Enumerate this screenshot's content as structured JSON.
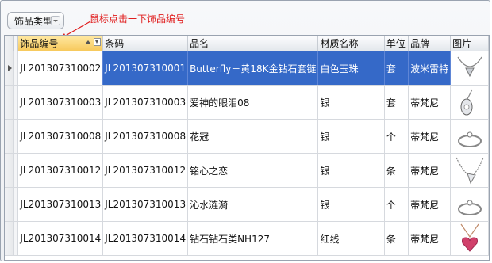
{
  "group_panel": {
    "chip_label": "饰品类型"
  },
  "hint_text": "鼠标点击一下饰品编号",
  "columns": [
    "饰品编号",
    "条码",
    "品名",
    "材质名称",
    "单位",
    "品牌",
    "图片"
  ],
  "rows": [
    {
      "id": "JL201307310002",
      "barcode": "JL201307310001",
      "name": "Butterfly－黄18K金钻石套链",
      "material": "白色玉珠",
      "unit": "套",
      "brand": "波米雷特",
      "picture": "necklace-icon"
    },
    {
      "id": "JL201307310003",
      "barcode": "JL201307310003",
      "name": "爱神的眼泪08",
      "material": "银",
      "unit": "套",
      "brand": "蒂梵尼",
      "picture": "pendant-icon"
    },
    {
      "id": "JL201307310008",
      "barcode": "JL201307310008",
      "name": "花冠",
      "material": "银",
      "unit": "个",
      "brand": "蒂梵尼",
      "picture": "ring-icon"
    },
    {
      "id": "JL201307310012",
      "barcode": "JL201307310012",
      "name": "铭心之恋",
      "material": "银",
      "unit": "条",
      "brand": "蒂梵尼",
      "picture": "chain-necklace-icon"
    },
    {
      "id": "JL201307310013",
      "barcode": "JL201307310013",
      "name": "沁水涟漪",
      "material": "银",
      "unit": "个",
      "brand": "蒂梵尼",
      "picture": "ring-icon"
    },
    {
      "id": "JL201307310014",
      "barcode": "JL201307310014",
      "name": "钻石钻石类NH127",
      "material": "红线",
      "unit": "条",
      "brand": "蒂梵尼",
      "picture": "heart-pendant-icon"
    }
  ],
  "selected_row": 0,
  "colors": {
    "selection": "#3569c8",
    "hint": "#e01b1b",
    "sorted_header": "#f7c95c"
  }
}
